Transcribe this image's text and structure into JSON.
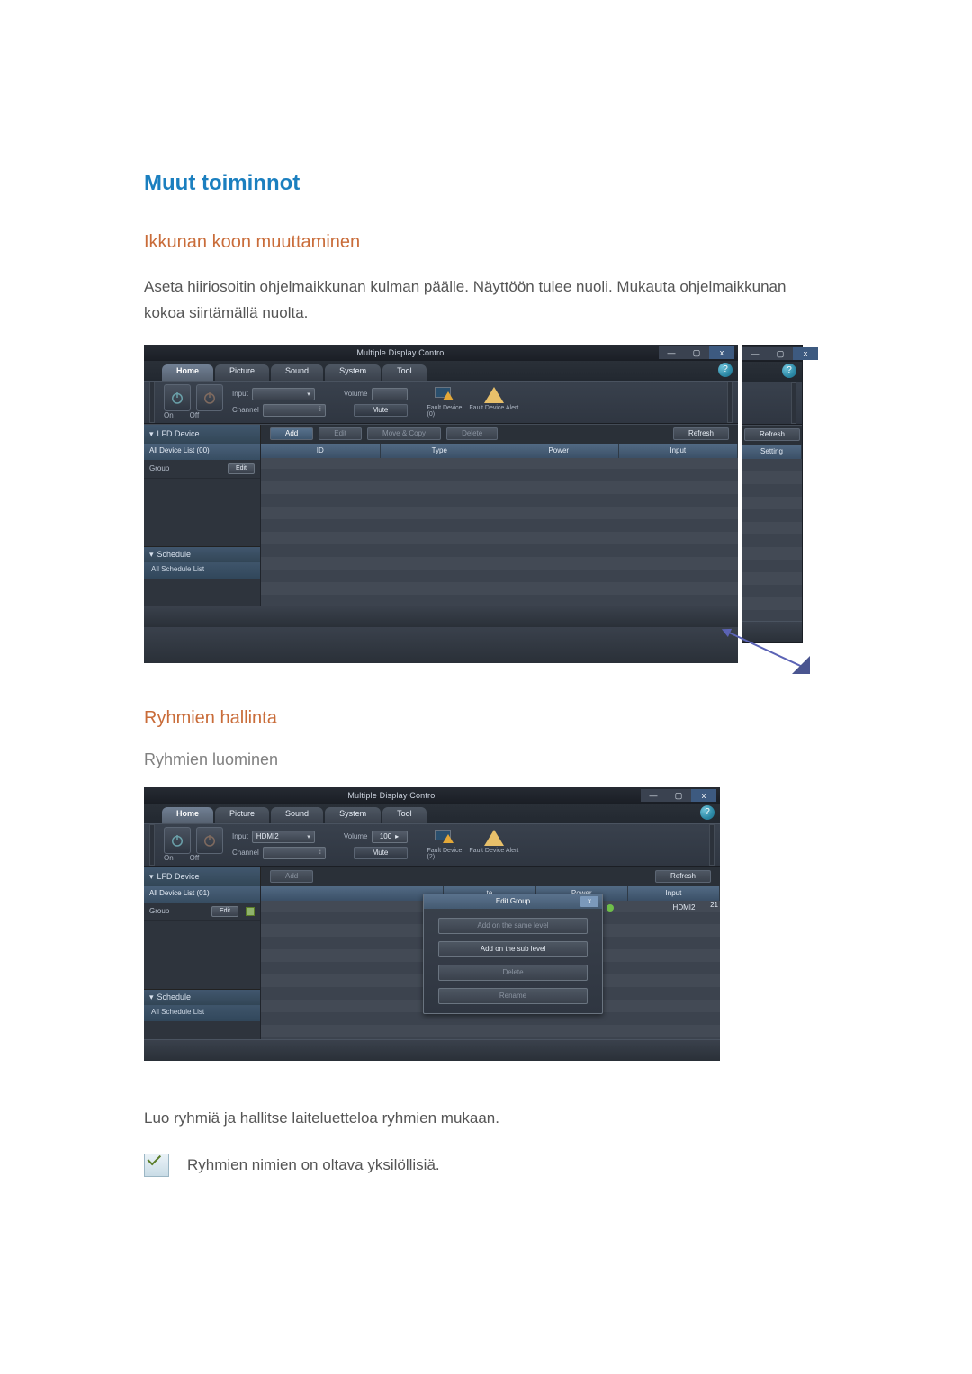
{
  "headings": {
    "main": "Muut toiminnot",
    "resize": "Ikkunan koon muuttaminen",
    "groups": "Ryhmien hallinta",
    "create_groups": "Ryhmien luominen"
  },
  "paragraphs": {
    "resize_body": "Aseta hiiriosoitin ohjelmaikkunan kulman päälle. Näyttöön tulee nuoli. Mukauta ohjelmaikkunan kokoa siirtämällä nuolta.",
    "groups_body": "Luo ryhmiä ja hallitse laiteluetteloa ryhmien mukaan.",
    "note": "Ryhmien nimien on oltava yksilöllisiä."
  },
  "app": {
    "title": "Multiple Display Control",
    "tabs": [
      "Home",
      "Picture",
      "Sound",
      "System",
      "Tool"
    ],
    "active_tab": "Home",
    "help": "?"
  },
  "win": {
    "min": "—",
    "max": "▢",
    "close": "x"
  },
  "ribbon": {
    "on": "On",
    "off": "Off",
    "input_label": "Input",
    "channel_label": "Channel",
    "volume_label": "Volume",
    "mute_label": "Mute",
    "fault_device": "Fault Device",
    "fault_alert": "Fault Device Alert",
    "fault_count_0": "(0)",
    "fault_count_2": "(2)",
    "input_value": "HDMI2",
    "volume_value": "100"
  },
  "sidebar": {
    "lfd": "LFD Device",
    "all_list_00": "All Device List (00)",
    "all_list_01": "All Device List (01)",
    "group": "Group",
    "edit": "Edit",
    "schedule": "Schedule",
    "all_schedule": "All Schedule List"
  },
  "toolbar": {
    "add": "Add",
    "edit": "Edit",
    "move_copy": "Move & Copy",
    "delete": "Delete",
    "refresh": "Refresh"
  },
  "columns_s1": [
    "ID",
    "Type",
    "Power",
    "Input"
  ],
  "columns_s1_right": "Setting",
  "columns_s2_right": [
    "te",
    "Power",
    "Input"
  ],
  "popup": {
    "title": "Edit Group",
    "close": "x",
    "items": [
      "Add on the same level",
      "Add on the sub level",
      "Delete",
      "Rename"
    ]
  },
  "row_data": {
    "input": "HDMI2",
    "num": "21"
  }
}
